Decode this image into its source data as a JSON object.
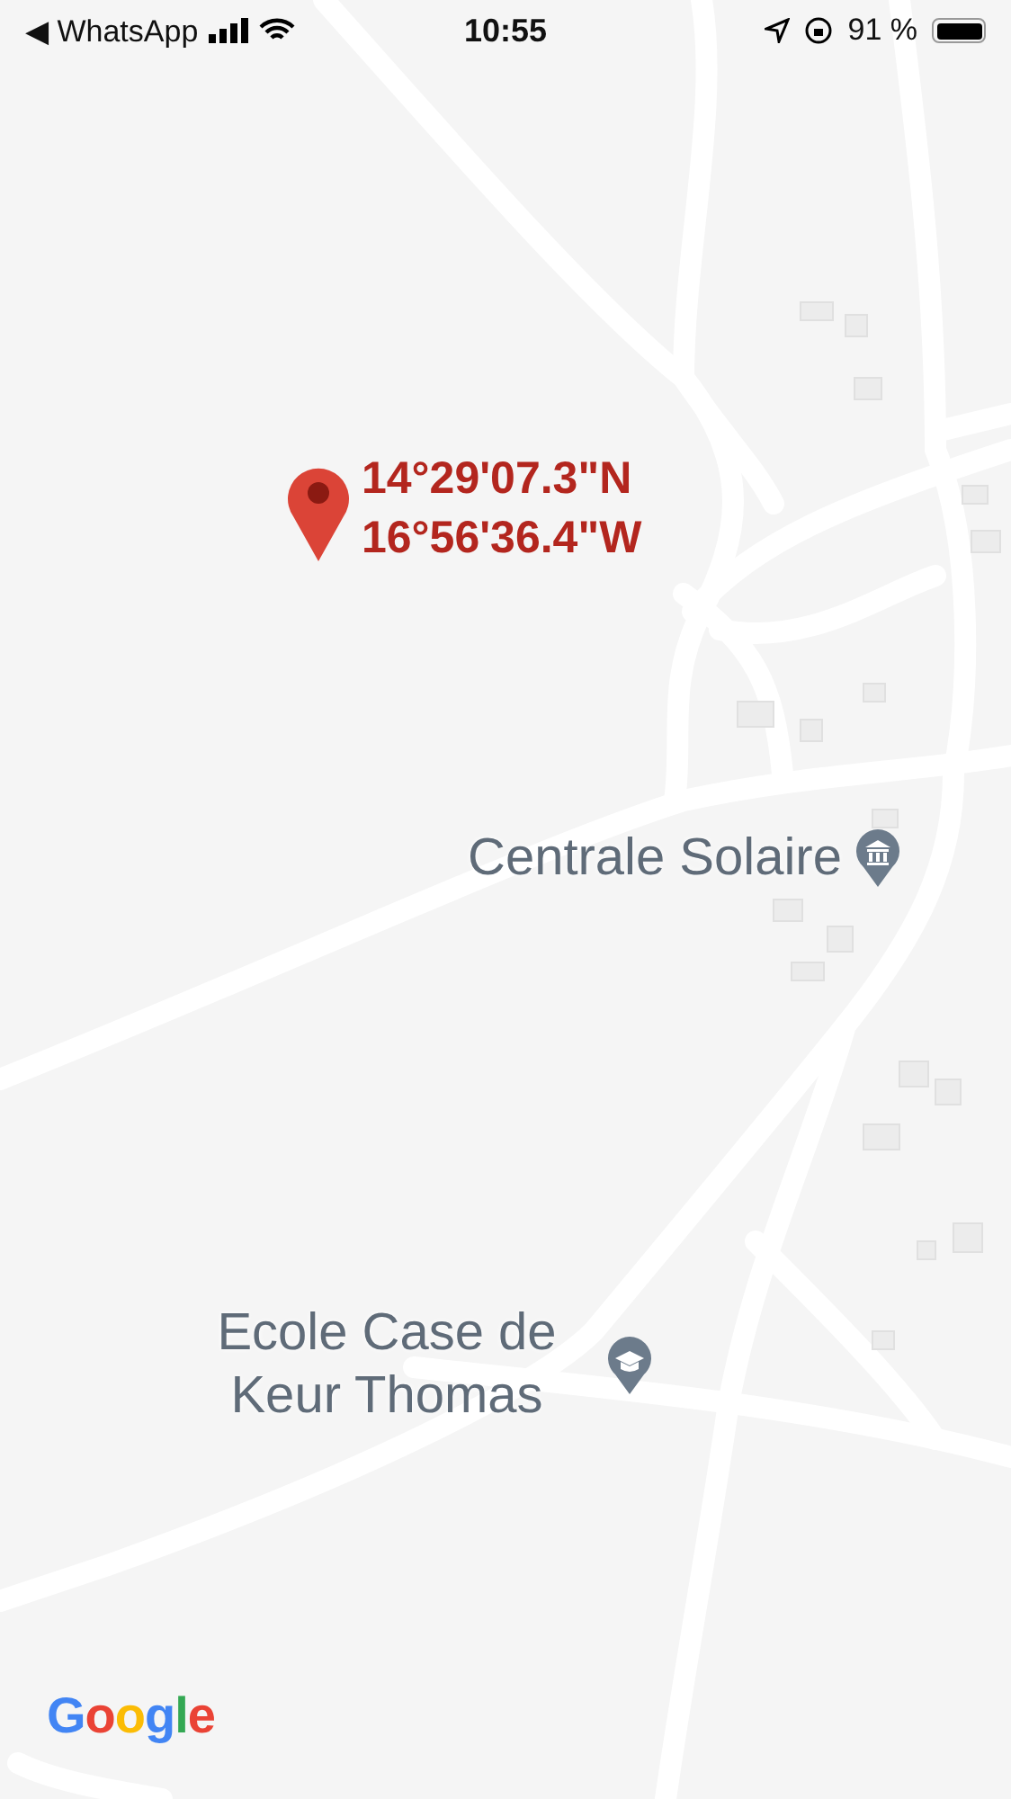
{
  "status_bar": {
    "back_label": "◀ WhatsApp",
    "time": "10:55",
    "battery_percent": "91 %"
  },
  "pin": {
    "latitude": "14°29'07.3\"N",
    "longitude": "16°56'36.4\"W"
  },
  "places": [
    {
      "name": "Centrale Solaire",
      "kind": "museum"
    },
    {
      "name": "Ecole Case de Keur Thomas",
      "kind": "school"
    }
  ],
  "logo": "Google"
}
